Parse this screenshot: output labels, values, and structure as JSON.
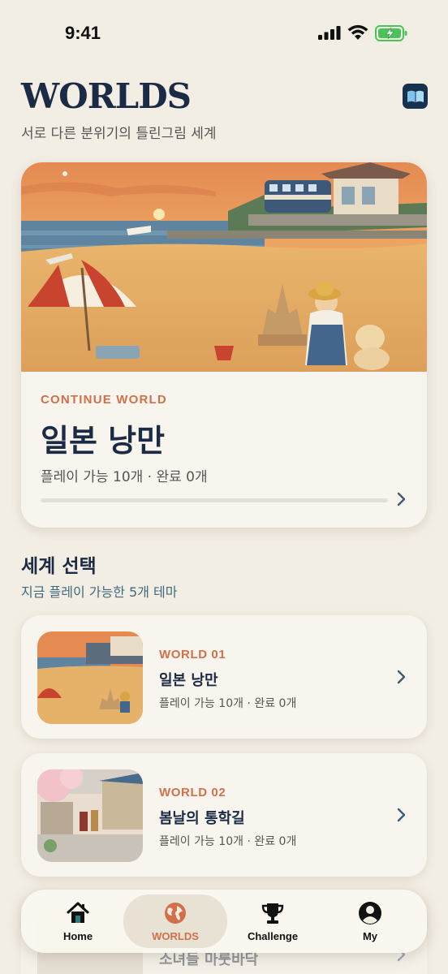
{
  "status_bar": {
    "time": "9:41"
  },
  "header": {
    "title": "WORLDS",
    "subtitle": "서로 다른 분위기의 틀린그림 세계",
    "book_icon": "open-book-icon"
  },
  "continue_card": {
    "eyebrow": "CONTINUE WORLD",
    "title": "일본 낭만",
    "stats": "플레이 가능 10개 · 완료 0개",
    "progress": 0
  },
  "section": {
    "title": "세계 선택",
    "subtitle": "지금 플레이 가능한 5개 테마"
  },
  "worlds": [
    {
      "number": "WORLD 01",
      "name": "일본 낭만",
      "stats": "플레이 가능 10개 · 완료 0개"
    },
    {
      "number": "WORLD 02",
      "name": "봄날의 통학길",
      "stats": "플레이 가능 10개 · 완료 0개"
    },
    {
      "name": "소녀들 마룻바닥"
    }
  ],
  "tabs": [
    {
      "label": "Home",
      "icon": "home-icon"
    },
    {
      "label": "WORLDS",
      "icon": "globe-icon",
      "active": true
    },
    {
      "label": "Challenge",
      "icon": "trophy-icon"
    },
    {
      "label": "My",
      "icon": "profile-icon"
    }
  ],
  "colors": {
    "accent": "#d2704a",
    "navy": "#1c2b45",
    "background": "#f3eee4"
  }
}
